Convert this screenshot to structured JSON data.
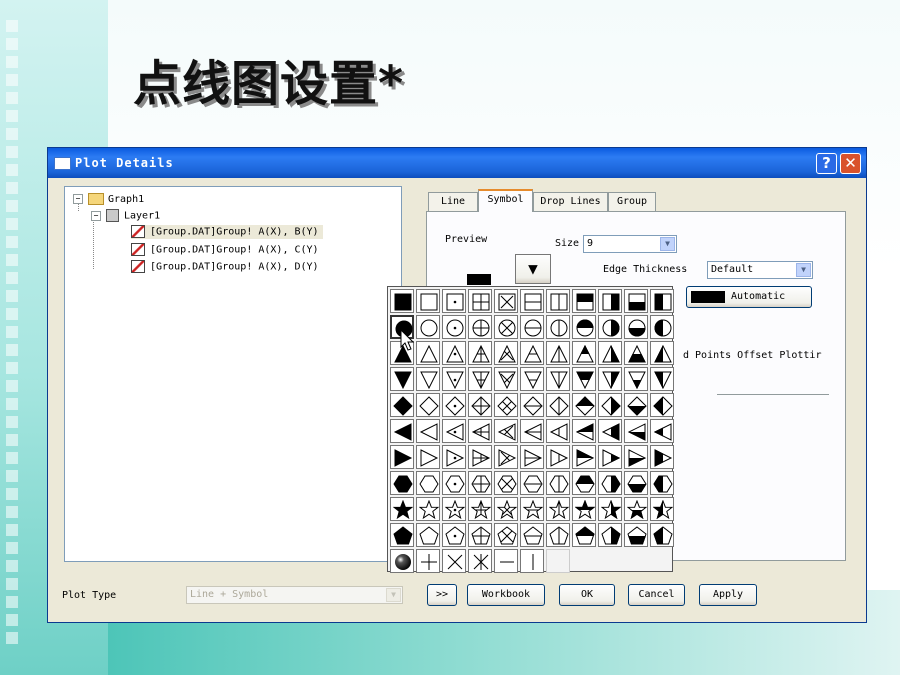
{
  "slide": {
    "title": "点线图设置*"
  },
  "window": {
    "title": "Plot Details",
    "help_glyph": "?",
    "close_glyph": "✕"
  },
  "tree": {
    "graph": "Graph1",
    "layer": "Layer1",
    "plots": [
      "[Group.DAT]Group! A(X), B(Y)",
      "[Group.DAT]Group! A(X), C(Y)",
      "[Group.DAT]Group! A(X), D(Y)"
    ],
    "collapse_glyph": "−"
  },
  "tabs": [
    "Line",
    "Symbol",
    "Drop Lines",
    "Group"
  ],
  "active_tab": "Symbol",
  "symbol_tab": {
    "preview_label": "Preview",
    "preview_dropdown_glyph": "▼",
    "size_label": "Size",
    "size_value": "9",
    "edge_thickness_label": "Edge Thickness",
    "edge_thickness_value": "Default",
    "color_label": "Automatic",
    "partial_text": "d Points Offset Plottir"
  },
  "symbol_grid": {
    "shapes": [
      "square",
      "circle",
      "triangle-up",
      "triangle-down",
      "diamond",
      "triangle-left",
      "triangle-right",
      "hexagon",
      "star",
      "pentagon"
    ],
    "styles": [
      "solid",
      "open",
      "dot-center",
      "plus-center",
      "x-center",
      "h-line",
      "v-line",
      "top-half",
      "right-half",
      "bottom-half",
      "left-half"
    ],
    "last_row": [
      "sphere",
      "plus",
      "x",
      "asterisk",
      "dash",
      "bar",
      "blank"
    ],
    "selected": {
      "row": 2,
      "col": 1
    }
  },
  "footer": {
    "plot_type_label": "Plot Type",
    "plot_type_value": "Line + Symbol",
    "expand_button": ">>",
    "workbook_button": "Workbook",
    "ok_button": "OK",
    "cancel_button": "Cancel",
    "apply_button": "Apply"
  }
}
